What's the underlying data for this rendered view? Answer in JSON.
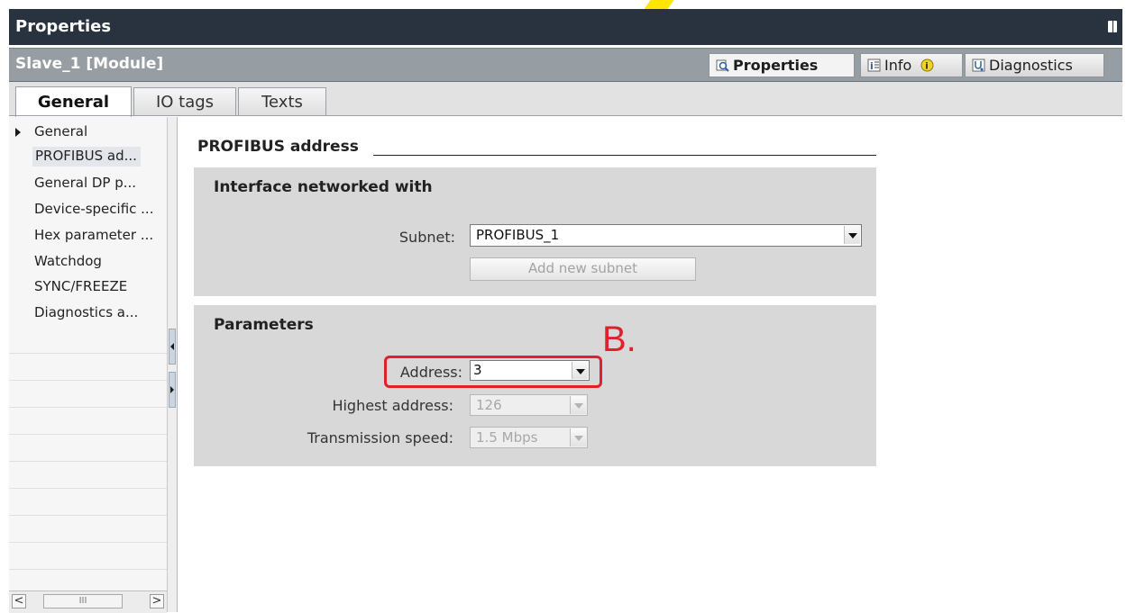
{
  "window": {
    "title": "Properties"
  },
  "object": {
    "name": "Slave_1 [Module]"
  },
  "right_tabs": [
    {
      "label": "Properties",
      "icon": "magnifier-icon",
      "active": true
    },
    {
      "label": "Info",
      "icon": "info-list-icon",
      "badge_icon": "info-circle-icon"
    },
    {
      "label": "Diagnostics",
      "icon": "stethoscope-icon"
    }
  ],
  "tabs": [
    {
      "label": "General",
      "active": true
    },
    {
      "label": "IO tags"
    },
    {
      "label": "Texts"
    }
  ],
  "nav": {
    "items": [
      {
        "label": "General",
        "expandable": true
      },
      {
        "label": "PROFIBUS ad...",
        "selected": true
      },
      {
        "label": "General DP p..."
      },
      {
        "label": "Device-specific ..."
      },
      {
        "label": "Hex parameter ..."
      },
      {
        "label": "Watchdog"
      },
      {
        "label": "SYNC/FREEZE"
      },
      {
        "label": "Diagnostics a..."
      }
    ],
    "scroll_left": "<",
    "scroll_right": ">",
    "scroll_grip": "III"
  },
  "main": {
    "section_title": "PROFIBUS address",
    "interface_group": {
      "title": "Interface networked with",
      "subnet_label": "Subnet:",
      "subnet_value": "PROFIBUS_1",
      "add_subnet_label": "Add new subnet"
    },
    "parameters_group": {
      "title": "Parameters",
      "address_label": "Address:",
      "address_value": "3",
      "highest_label": "Highest address:",
      "highest_value": "126",
      "speed_label": "Transmission speed:",
      "speed_value": "1.5 Mbps"
    }
  },
  "annotation": {
    "text": "B.",
    "color": "#e0202a"
  },
  "colors": {
    "title_bar": "#29323f",
    "subtitle_bar": "#979ea3",
    "group_bg": "#d8d8d8"
  }
}
